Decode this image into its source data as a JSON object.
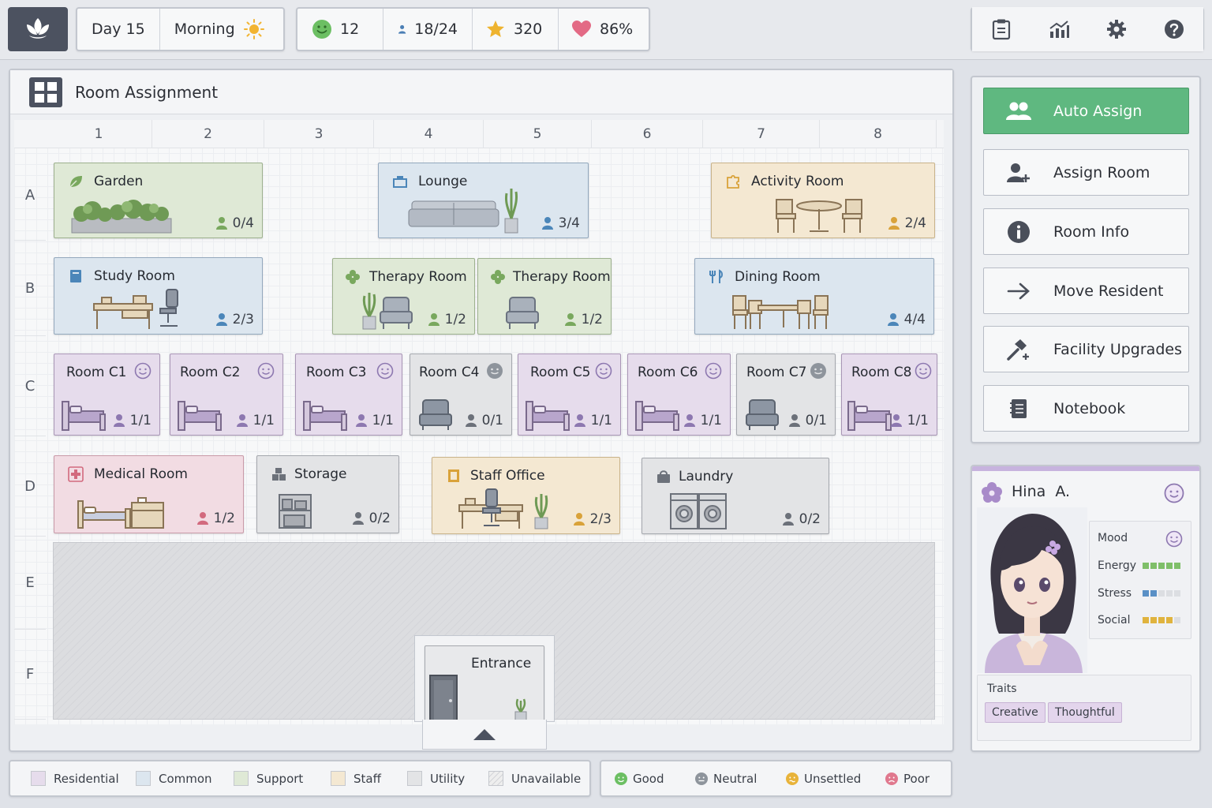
{
  "topbar": {
    "day": "Day 15",
    "time_of_day": "Morning",
    "happy_count": "12",
    "residents": "18/24",
    "stars": "320",
    "health": "86%",
    "icons": [
      "logo-leaf-icon",
      "sun-icon",
      "smiley-icon",
      "person-icon",
      "star-icon",
      "heart-icon",
      "clipboard-icon",
      "chart-icon",
      "gear-icon",
      "help-icon"
    ]
  },
  "room_panel": {
    "title": "Room Assignment",
    "columns": [
      "1",
      "2",
      "3",
      "4",
      "5",
      "6",
      "7",
      "8"
    ],
    "rows": [
      "A",
      "B",
      "C",
      "D",
      "E",
      "F"
    ]
  },
  "rooms": {
    "garden": {
      "name": "Garden",
      "occ": "0/4"
    },
    "lounge": {
      "name": "Lounge",
      "occ": "3/4"
    },
    "activity": {
      "name": "Activity Room",
      "occ": "2/4"
    },
    "study": {
      "name": "Study Room",
      "occ": "2/3"
    },
    "therapy1": {
      "name": "Therapy Room",
      "occ": "1/2"
    },
    "therapy2": {
      "name": "Therapy Room",
      "occ": "1/2"
    },
    "dining": {
      "name": "Dining Room",
      "occ": "4/4"
    },
    "c1": {
      "name": "Room C1",
      "occ": "1/1"
    },
    "c2": {
      "name": "Room C2",
      "occ": "1/1"
    },
    "c3": {
      "name": "Room C3",
      "occ": "1/1"
    },
    "c4": {
      "name": "Room C4",
      "occ": "0/1"
    },
    "c5": {
      "name": "Room C5",
      "occ": "1/1"
    },
    "c6": {
      "name": "Room C6",
      "occ": "1/1"
    },
    "c7": {
      "name": "Room C7",
      "occ": "0/1"
    },
    "c8": {
      "name": "Room C8",
      "occ": "1/1"
    },
    "medical": {
      "name": "Medical Room",
      "occ": "1/2"
    },
    "storage": {
      "name": "Storage",
      "occ": "0/2"
    },
    "staff": {
      "name": "Staff Office",
      "occ": "2/3"
    },
    "laundry": {
      "name": "Laundry",
      "occ": "0/2"
    },
    "entrance": {
      "name": "Entrance"
    }
  },
  "actions": {
    "auto_assign": "Auto Assign",
    "assign_room": "Assign Room",
    "room_info": "Room Info",
    "move_resident": "Move Resident",
    "facility_upgrades": "Facility Upgrades",
    "notebook": "Notebook"
  },
  "resident": {
    "name": "Hina  A.",
    "stats": {
      "mood_label": "Mood",
      "energy_label": "Energy",
      "energy_level": 5,
      "stress_label": "Stress",
      "stress_level": 2,
      "social_label": "Social",
      "social_level": 4
    },
    "traits_label": "Traits",
    "traits": [
      "Creative",
      "Thoughtful"
    ]
  },
  "legend": {
    "types": [
      "Residential",
      "Common",
      "Support",
      "Staff",
      "Utility",
      "Unavailable"
    ],
    "type_colors": [
      "#e6dcec",
      "#dce6ef",
      "#dfe9d6",
      "#f4e8d2",
      "#e3e4e6",
      "#eeeeee"
    ],
    "moods": [
      "Good",
      "Neutral",
      "Unsettled",
      "Poor"
    ],
    "mood_colors": [
      "#6cbf63",
      "#8e949c",
      "#e8b33a",
      "#e0788e"
    ]
  },
  "colors": {
    "accent_green": "#5fb880",
    "residential": "#8d78b0",
    "common": "#4b86b9",
    "support": "#79a85e",
    "staff": "#d9a23a",
    "utility": "#7a7f88",
    "medical": "#d26a7e"
  }
}
